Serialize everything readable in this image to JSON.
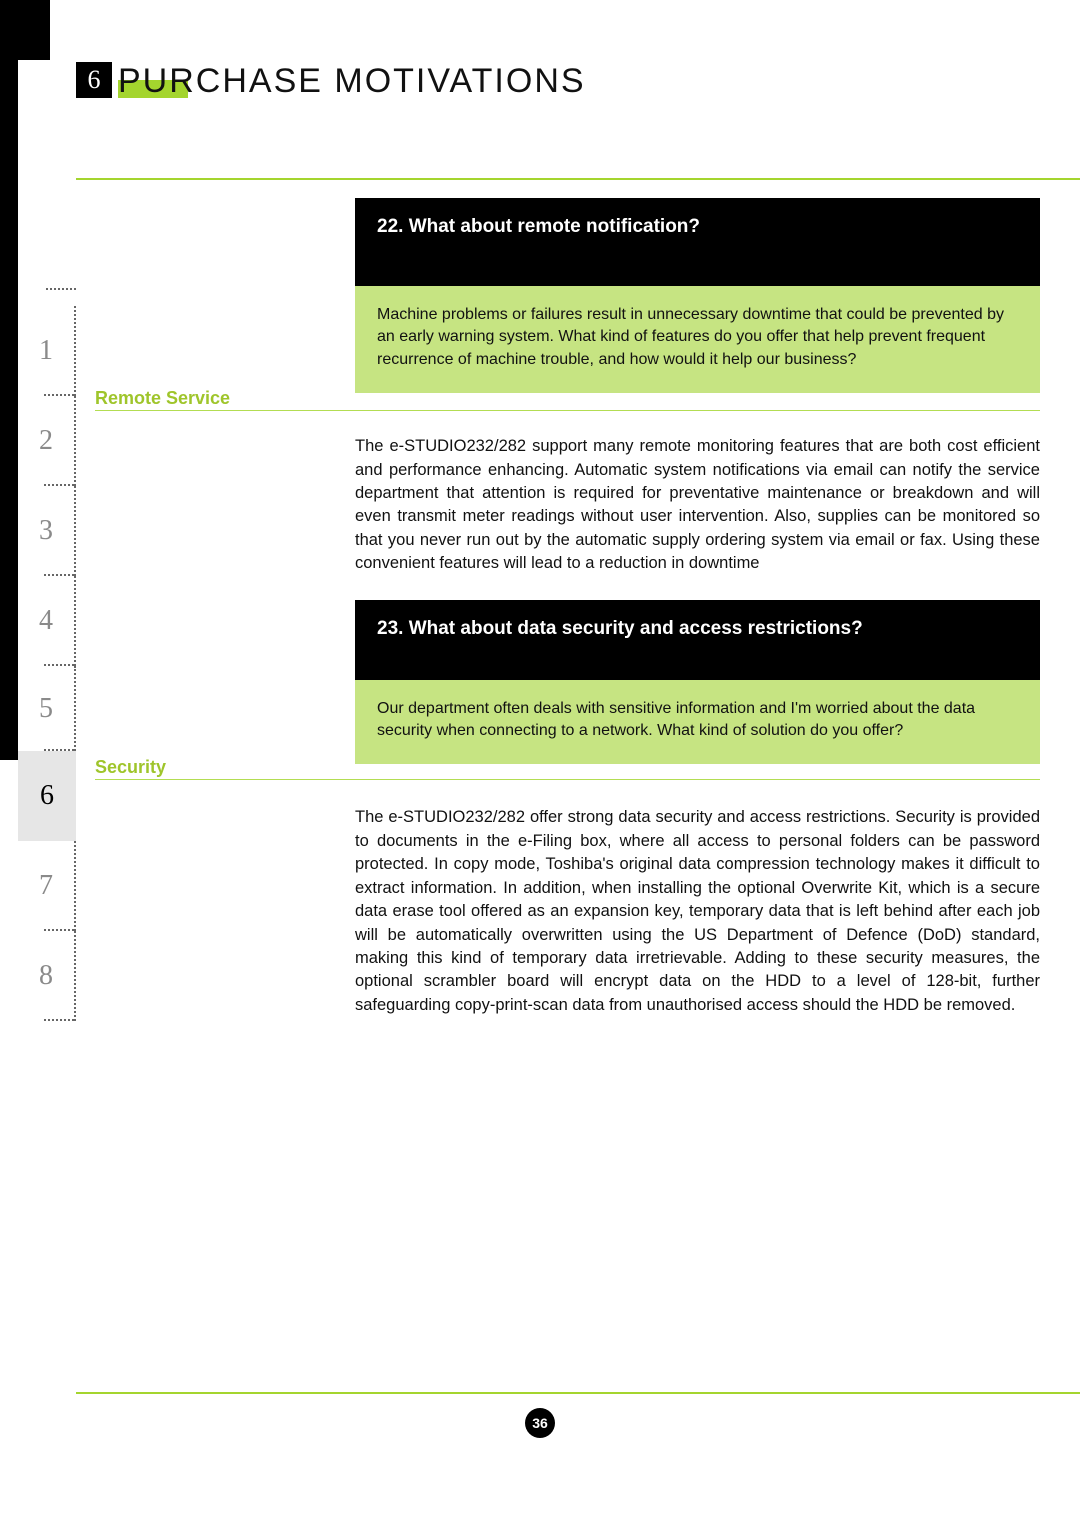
{
  "chapter": {
    "number": "6",
    "title": "PURCHASE MOTIVATIONS"
  },
  "tabs": [
    "1",
    "2",
    "3",
    "4",
    "5",
    "6",
    "7",
    "8"
  ],
  "active_tab_index": 5,
  "sections": [
    {
      "q_header": "22. What about remote notification?",
      "q_body": "Machine problems or failures result in unnecessary downtime that could be prevented by an early warning system. What kind of features do you offer that help prevent frequent recurrence of machine trouble, and how would it help our business?",
      "label": "Remote Service",
      "answer": "The e-STUDIO232/282 support many remote monitoring features that are both cost efficient and performance enhancing. Automatic system notifications via email can notify the service department that attention is required for preventative maintenance or breakdown and will even transmit meter readings without user intervention. Also, supplies can be monitored so that you never run out by the automatic supply ordering system via email or fax. Using these convenient features will lead to a reduction in downtime"
    },
    {
      "q_header": "23. What about data security and access restrictions?",
      "q_body": "Our department often deals with sensitive information and I'm worried about the data security when connecting to a network. What kind of solution do you offer?",
      "label": "Security",
      "answer": "The e-STUDIO232/282 offer strong data security and access restrictions. Security is provided to documents in the e-Filing box, where all access to personal folders can be password protected. In copy mode, Toshiba's original data compression technology makes it difficult to extract information. In addition, when installing the optional Overwrite Kit, which is a secure data erase tool offered as an expansion key, temporary data that is left behind after each job will be automatically overwritten using the US Department of Defence (DoD) standard, making  this kind of temporary data irretrievable. Adding to these security measures, the optional scrambler board will encrypt data on the HDD to a level of 128-bit, further safeguarding copy-print-scan data from unauthorised access should the HDD be removed."
    }
  ],
  "page_number": "36"
}
